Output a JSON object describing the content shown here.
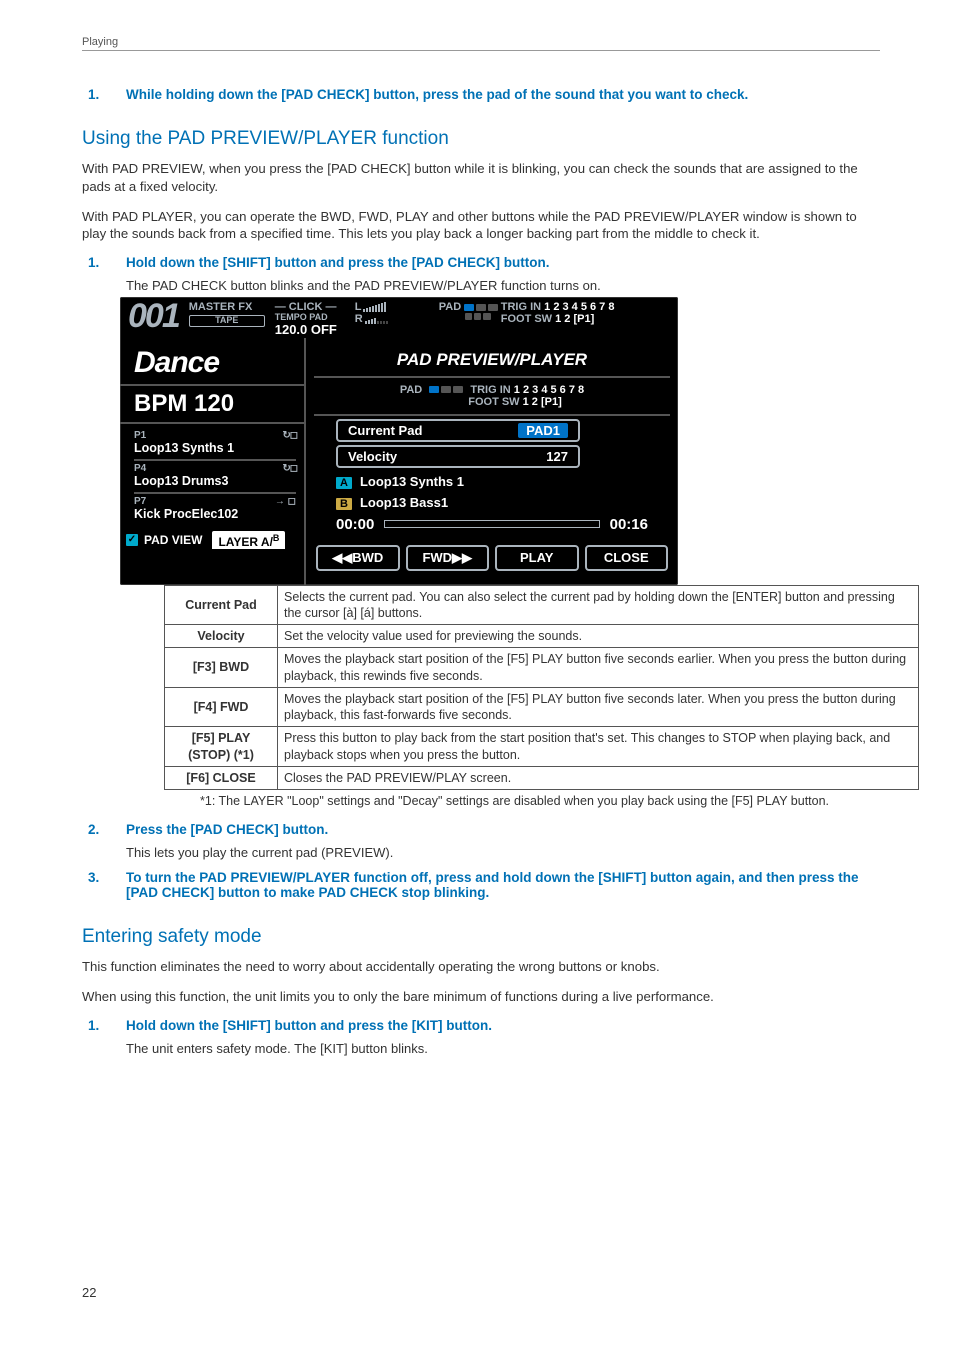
{
  "header": {
    "section": "Playing"
  },
  "intro_step": {
    "num": "1.",
    "text": "While holding down the [PAD CHECK] button, press the pad of the sound that you want to check."
  },
  "sect1": {
    "title": "Using the PAD PREVIEW/PLAYER function",
    "p1": "With PAD PREVIEW, when you press the [PAD CHECK] button while it is blinking, you can check the sounds that are assigned to the pads at a fixed velocity.",
    "p2": "With PAD PLAYER, you can operate the BWD, FWD, PLAY and other buttons while the PAD PREVIEW/PLAYER window is shown to play the sounds back from a specified time. This lets you play back a longer backing part from the middle to check it.",
    "step1_num": "1.",
    "step1_text": "Hold down the [SHIFT] button and press the [PAD CHECK] button.",
    "step1_sub": "The PAD CHECK button blinks and the PAD PREVIEW/PLAYER function turns on."
  },
  "lcd": {
    "bignum": "001",
    "masterfx": "MASTER FX",
    "tape": "TAPE",
    "click": "— CLICK —",
    "tempo_pad": "TEMPO   PAD",
    "tempo_val": "120.0 OFF",
    "L": "L",
    "R": "R",
    "padlabel": "PAD",
    "trigin": "TRIG IN",
    "trignums": "1 2 3 4 5 6 7 8",
    "footsw": "FOOT SW",
    "footsw_val": "1 2 [P1]",
    "dance": "Dance",
    "bpm": "BPM 120",
    "pads": [
      {
        "slot": "P1",
        "name": "Loop13 Synths 1",
        "icons": "loop"
      },
      {
        "slot": "P4",
        "name": "Loop13 Drums3",
        "icons": "loop"
      },
      {
        "slot": "P7",
        "name": "Kick ProcElec102",
        "icons": "arrow"
      }
    ],
    "padview": "PAD VIEW",
    "layer_tab": "LAYER A/",
    "title": "PAD PREVIEW/PLAYER",
    "field_currentpad_label": "Current Pad",
    "field_currentpad_val": "PAD1",
    "field_velocity_label": "Velocity",
    "field_velocity_val": "127",
    "ab_A": "Loop13 Synths 1",
    "ab_B": "Loop13 Bass1",
    "time_start": "00:00",
    "time_end": "00:16",
    "btn_bwd": "◀◀BWD",
    "btn_fwd": "FWD▶▶",
    "btn_play": "PLAY",
    "btn_close": "CLOSE"
  },
  "table": [
    {
      "label": "Current Pad",
      "desc": "Selects the current pad.\nYou can also select the current pad by holding down the [ENTER] button and pressing the cursor [à] [á] buttons."
    },
    {
      "label": "Velocity",
      "desc": "Set the velocity value used for previewing the sounds."
    },
    {
      "label": "[F3] BWD",
      "desc": "Moves the playback start position of the [F5] PLAY button five seconds earlier. When you press the button during playback, this rewinds five seconds."
    },
    {
      "label": "[F4] FWD",
      "desc": "Moves the playback start position of the [F5] PLAY button five seconds later. When you press the button during playback, this fast-forwards five seconds."
    },
    {
      "label": "[F5] PLAY (STOP) (*1)",
      "desc": "Press this button to play back from the start position that's set.\nThis changes to STOP when playing back, and playback stops when you press the button."
    },
    {
      "label": "[F6] CLOSE",
      "desc": "Closes the PAD PREVIEW/PLAY screen."
    }
  ],
  "footnote": "*1: The LAYER \"Loop\" settings and \"Decay\" settings are disabled when you play back using the [F5] PLAY button.",
  "sect1_steps_after": [
    {
      "num": "2.",
      "text": "Press the [PAD CHECK] button.",
      "sub": "This lets you play the current pad (PREVIEW)."
    },
    {
      "num": "3.",
      "text": "To turn the PAD PREVIEW/PLAYER function off, press and hold down the [SHIFT] button again, and then press the [PAD CHECK] button to make PAD CHECK stop blinking."
    }
  ],
  "sect2": {
    "title": "Entering safety mode",
    "p1": "This function eliminates the need to worry about accidentally operating the wrong buttons or knobs.",
    "p2": "When using this function, the unit limits you to only the bare minimum of functions during a live performance.",
    "step1_num": "1.",
    "step1_text": "Hold down the [SHIFT] button and press the [KIT] button.",
    "step1_sub": "The unit enters safety mode. The [KIT] button blinks."
  },
  "page": "22"
}
